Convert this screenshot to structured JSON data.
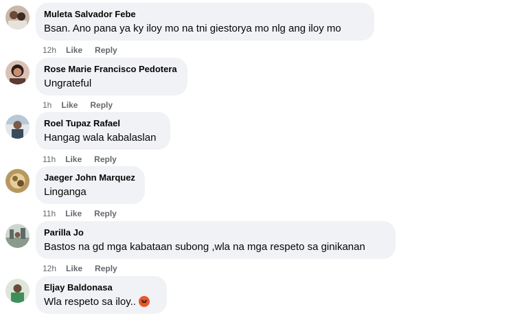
{
  "comments": [
    {
      "author": "Muleta Salvador Febe",
      "text": "Bsan. Ano pana ya ky iloy mo na tni giestorya mo nlg ang iloy mo",
      "time": "12h",
      "like": "Like",
      "reply": "Reply"
    },
    {
      "author": "Rose Marie Francisco Pedotera",
      "text": "Ungrateful",
      "time": "1h",
      "like": "Like",
      "reply": "Reply"
    },
    {
      "author": "Roel Tupaz Rafael",
      "text": "Hangag wala kabalaslan",
      "time": "11h",
      "like": "Like",
      "reply": "Reply"
    },
    {
      "author": "Jaeger John Marquez",
      "text": "Linganga",
      "time": "11h",
      "like": "Like",
      "reply": "Reply"
    },
    {
      "author": "Parilla Jo",
      "text": "Bastos na gd mga kabataan subong ,wla na mga respeto sa ginikanan",
      "time": "12h",
      "like": "Like",
      "reply": "Reply"
    },
    {
      "author": "Eljay Baldonasa",
      "text": "Wla respeto sa iloy..",
      "emoji": "pouting-face-icon",
      "time": null,
      "like": null,
      "reply": null
    }
  ],
  "colors": {
    "bubble": "#f0f2f5",
    "meta": "#65676b",
    "text": "#050505"
  }
}
